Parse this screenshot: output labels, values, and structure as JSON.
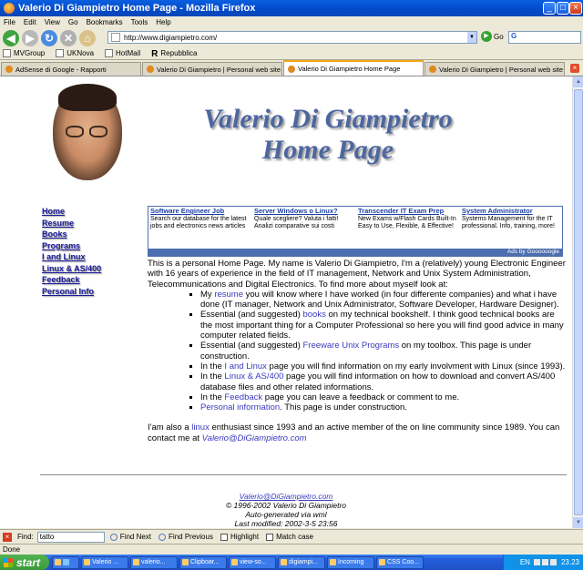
{
  "window": {
    "title": "Valerio Di Giampietro Home Page - Mozilla Firefox"
  },
  "menu": [
    "File",
    "Edit",
    "View",
    "Go",
    "Bookmarks",
    "Tools",
    "Help"
  ],
  "nav": {
    "url": "http://www.digiampietro.com/",
    "go_label": "Go",
    "search_value": "G"
  },
  "bookmarks": [
    "MVGroup",
    "UKNova",
    "HotMail",
    "Repubblica"
  ],
  "tabs": [
    "AdSense di Google - Rapporti",
    "Valerio Di Giampietro | Personal web site an...",
    "Valerio Di Giampietro Home Page",
    "Valerio Di Giampietro | Personal web site an..."
  ],
  "page": {
    "title_line1": "Valerio Di Giampietro",
    "title_line2": "Home Page",
    "sidebar": [
      "Home",
      "Resume",
      "Books",
      "Programs",
      "I and Linux",
      "Linux & AS/400",
      "Feedback",
      "Personal Info"
    ],
    "ads": [
      {
        "title": "Software Engineer Job",
        "text": "Search our database for the latest jobs and electronics news articles"
      },
      {
        "title": "Server Windows o Linux?",
        "text": "Quale scegliere? Valuta i fatti! Analizi comparative sui costi"
      },
      {
        "title": "Transcender IT Exam Prep",
        "text": "New Exams w/Flash Cards Built-In Easy to Use, Flexible, & Effective!"
      },
      {
        "title": "System Administrator",
        "text": "Systems Management for the IT professional. Info, training, more!"
      }
    ],
    "ads_by": "Ads by Goooooogle",
    "intro": "This is a personal Home Page. My name is Valerio Di Giampietro, I'm a (relatively) young Electronic Engineer with 16 years of experience in the field of IT management, Network and Unix System Administration, Telecommunications and Digital Electronics. To find more about myself look at:",
    "items": [
      {
        "pre": "My ",
        "link": "resume",
        "post": " you will know where I have worked (in four differente companies) and what i have done (IT manager, Network and Unix Administrator, Software Developer, Hardware Designer)."
      },
      {
        "pre": "Essential (and suggested) ",
        "link": "books",
        "post": " on my technical bookshelf. I think good technical books are the most important thing for a Computer Professional so here you will find good advice in many computer related fields."
      },
      {
        "pre": "Essential (and suggested) ",
        "link": "Freeware Unix Programs",
        "post": " on my toolbox. This page is under construction."
      },
      {
        "pre": "In the ",
        "link": "I and Linux",
        "post": " page you will find information on my early involvment with Linux (since 1993)."
      },
      {
        "pre": "In the ",
        "link": "Linux & AS/400",
        "post": " page you will find information on how to download and convert AS/400 database files and other related informations."
      },
      {
        "pre": "In the ",
        "link": "Feedback",
        "post": " page you can leave a feedback or comment to me."
      },
      {
        "pre": "",
        "link": "Personal information",
        "post": ". This page is under construction."
      }
    ],
    "outro_pre": "I'am also a ",
    "outro_link": "linux",
    "outro_post": " enthusiast since 1993 and an active member of the on line community since 1989. You can contact me at ",
    "outro_email": "Valerio@DiGiampietro.com",
    "footer": [
      "Valerio@DiGiampietro.com",
      "© 1996-2002 Valerio Di Giampietro",
      "Auto-generated via wml",
      "Last modified: 2002-3-5 23:56"
    ]
  },
  "find": {
    "label": "Find:",
    "value": "tatto",
    "next": "Find Next",
    "previous": "Find Previous",
    "highlight": "Highlight",
    "match_case": "Match case"
  },
  "status": "Done",
  "taskbar": {
    "start": "start",
    "items": [
      "Valerio ...",
      "valerio...",
      "Clipboar...",
      "view-so...",
      "digiampi...",
      "Incoming",
      "CSS Coo..."
    ],
    "tray_lang": "EN",
    "clock": "23.23"
  }
}
